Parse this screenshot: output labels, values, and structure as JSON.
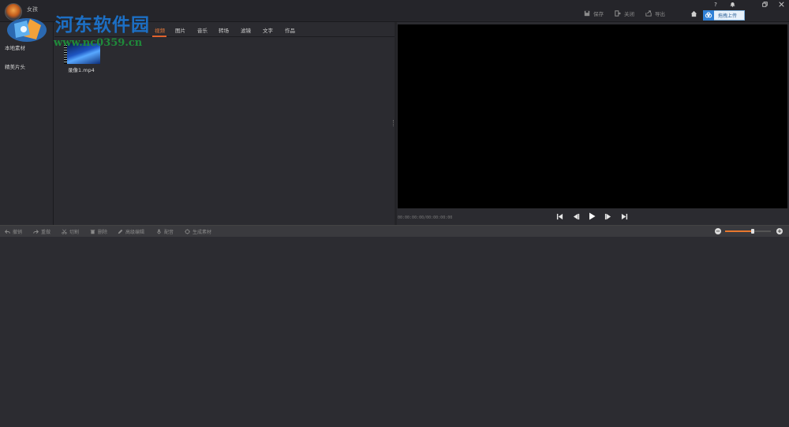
{
  "app": {
    "username": "女孩"
  },
  "watermark": {
    "title": "河东软件园",
    "url": "www.nc0359.cn"
  },
  "top_actions": [
    {
      "label": "保存",
      "icon": "save-icon"
    },
    {
      "label": "关闭",
      "icon": "close-project-icon"
    },
    {
      "label": "导出",
      "icon": "export-icon"
    }
  ],
  "cloud": {
    "upload_label": "拖拽上传"
  },
  "window_controls": [
    "?",
    "bell",
    "restore",
    "close"
  ],
  "left_nav": [
    {
      "label": "本地素材"
    },
    {
      "label": "精美片头"
    }
  ],
  "tabs": [
    {
      "label": "视频",
      "active": true
    },
    {
      "label": "图片"
    },
    {
      "label": "音乐"
    },
    {
      "label": "转场"
    },
    {
      "label": "滤镜"
    },
    {
      "label": "文字"
    },
    {
      "label": "作品"
    }
  ],
  "media_items": [
    {
      "name": "录像1.mp4"
    }
  ],
  "preview": {
    "timecode": "00:00:00:00/00:00:00:00"
  },
  "edit_tools": [
    {
      "label": "撤销",
      "icon": "undo-icon"
    },
    {
      "label": "重做",
      "icon": "redo-icon"
    },
    {
      "label": "切割",
      "icon": "scissors-icon"
    },
    {
      "label": "删除",
      "icon": "trash-icon"
    },
    {
      "label": "高级编辑",
      "icon": "pencil-icon"
    },
    {
      "label": "配音",
      "icon": "microphone-icon"
    },
    {
      "label": "生成素材",
      "icon": "generate-icon"
    }
  ],
  "zoom": {
    "level": 0.6
  },
  "colors": {
    "accent": "#e8772e",
    "upload_blue": "#2f80d6",
    "watermark_blue": "#1c6fc4",
    "watermark_green": "#1f8a3a"
  }
}
